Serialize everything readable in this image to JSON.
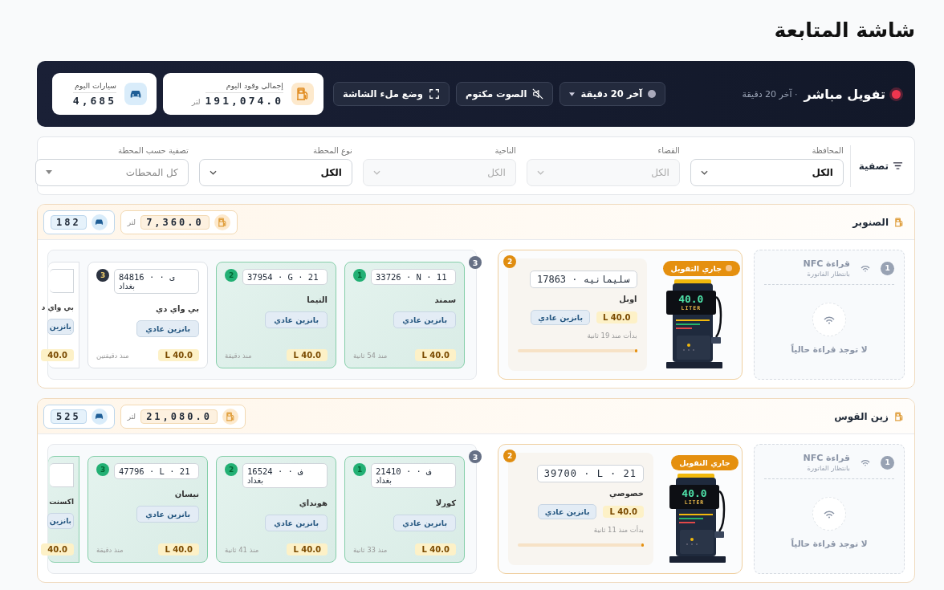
{
  "page_title": "شاشة المتابعة",
  "live_bar": {
    "title": "تفويل مباشر",
    "live": true,
    "subtitle": "· آخر 20 دقيقة",
    "range_select": {
      "value": "آخر 20 دقيقة"
    },
    "sound_button": {
      "label": "الصوت مكتوم",
      "muted": true
    },
    "fullscreen_button": {
      "label": "وضع ملء الشاشة"
    },
    "stats": [
      {
        "kind": "fuel",
        "label": "إجمالي وقود اليوم",
        "value": "191,074.0",
        "unit": "لتر"
      },
      {
        "kind": "cars",
        "label": "سيارات اليوم",
        "value": "4,685"
      }
    ]
  },
  "filters": {
    "title": "تصفية",
    "fields": [
      {
        "label": "المحافظة",
        "value": "الكل",
        "disabled": false
      },
      {
        "label": "القضاء",
        "value": "الكل",
        "disabled": true
      },
      {
        "label": "الناحية",
        "value": "الكل",
        "disabled": true
      },
      {
        "label": "نوع المحطة",
        "value": "الكل",
        "disabled": false
      },
      {
        "label": "تصفية حسب المحطة",
        "placeholder": "كل المحطات",
        "disabled": false
      }
    ]
  },
  "stations": [
    {
      "name": "الصنوبر",
      "fuel_total": "7,360.0",
      "fuel_unit": "لتر",
      "cars": "182",
      "nfc": {
        "index": "1",
        "title": "قراءة NFC",
        "status": "بانتظار الفاتورة",
        "empty_text": "لا توجد قراءة حالياً"
      },
      "pump": {
        "status": "جاري التفويل",
        "pulse": true,
        "reading": "40.0",
        "unit": "LITER"
      },
      "current": {
        "index": "2",
        "plate": [
          "17863 · سليمانيه"
        ],
        "model": "اوبل",
        "liters": "L 40.0",
        "fuel": "بانزين عادي",
        "started": "بدأت منذ 19 ثانية",
        "level": 0.02
      },
      "queue": {
        "count": "3",
        "vehicles": [
          {
            "partial": false,
            "highlighted": true,
            "index": "1",
            "plate": [
              "33726 · N · 11"
            ],
            "model": "سمند",
            "fuel": "بانزين عادي",
            "liters": "L 40.0",
            "time": "منذ 54 ثانية"
          },
          {
            "partial": false,
            "highlighted": true,
            "index": "2",
            "plate": [
              "37954 · G · 21"
            ],
            "model": "التيما",
            "fuel": "بانزين عادي",
            "liters": "L 40.0",
            "time": "منذ دقيقة"
          },
          {
            "partial": false,
            "highlighted": false,
            "index": "3",
            "plate": [
              "84816 · · ى",
              "بغداد"
            ],
            "model": "بي واي دي",
            "fuel": "بانزين عادي",
            "liters": "L 40.0",
            "time": "منذ دقيقتين"
          },
          {
            "partial": true,
            "highlighted": false,
            "model": "بي واي د",
            "fuel": "بانزين",
            "liters": "40.0"
          }
        ]
      }
    },
    {
      "name": "زين القوس",
      "fuel_total": "21,080.0",
      "fuel_unit": "لتر",
      "cars": "525",
      "nfc": {
        "index": "1",
        "title": "قراءة NFC",
        "status": "بانتظار الفاتورة",
        "empty_text": "لا توجد قراءة حالياً"
      },
      "pump": {
        "status": "جاري التفويل",
        "pulse": false,
        "reading": "40.0",
        "unit": "LITER"
      },
      "current": {
        "index": "2",
        "plate": [
          "39700 · L · 21"
        ],
        "model": "خصوصي",
        "liters": "L 40.0",
        "fuel": "بانزين عادي",
        "started": "بدأت منذ 11 ثانية",
        "level": 0.02
      },
      "queue": {
        "count": "3",
        "vehicles": [
          {
            "partial": false,
            "highlighted": true,
            "index": "1",
            "plate": [
              "21410 · · ف",
              "بغداد"
            ],
            "model": "كورلا",
            "fuel": "بانزين عادي",
            "liters": "L 40.0",
            "time": "منذ 33 ثانية"
          },
          {
            "partial": false,
            "highlighted": true,
            "index": "2",
            "plate": [
              "16524 · · ف",
              "بغداد"
            ],
            "model": "هونداي",
            "fuel": "بانزين عادي",
            "liters": "L 40.0",
            "time": "منذ 41 ثانية"
          },
          {
            "partial": false,
            "highlighted": true,
            "index": "3",
            "plate": [
              "47796 · L · 21"
            ],
            "model": "نيسان",
            "fuel": "بانزين عادي",
            "liters": "L 40.0",
            "time": "منذ دقيقة"
          },
          {
            "partial": true,
            "highlighted": true,
            "model": "اكسنت",
            "fuel": "بانزين",
            "liters": "40.0"
          }
        ]
      }
    }
  ]
}
